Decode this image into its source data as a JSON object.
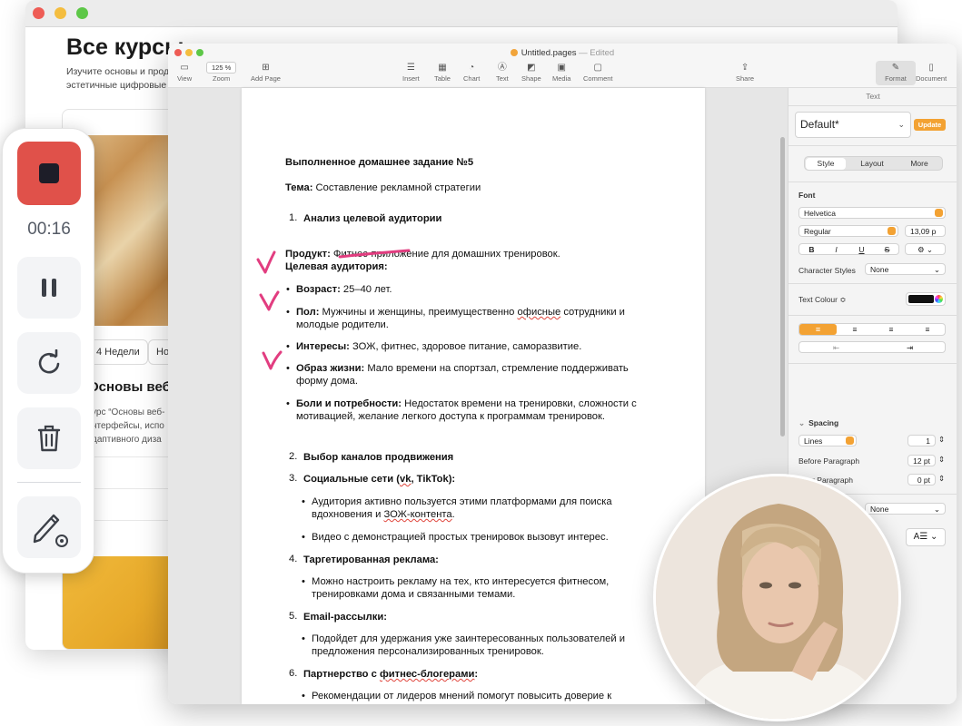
{
  "background_page": {
    "title": "Все курсы",
    "subtitle": "Изучите основы и продв эстетичные цифровые п",
    "chips": [
      "4 Недели",
      "Но"
    ],
    "course_title": "Основы веб",
    "course_desc": "урс “Основы веб- нтерфейсы, испо даптивного диза"
  },
  "recorder": {
    "timer": "00:16"
  },
  "pages": {
    "doc_name": "Untitled.pages",
    "edited": "— Edited",
    "toolbar": {
      "view": "View",
      "zoom_value": "125 %",
      "zoom": "Zoom",
      "add_page": "Add Page",
      "insert": "Insert",
      "table": "Table",
      "chart": "Chart",
      "text": "Text",
      "shape": "Shape",
      "media": "Media",
      "comment": "Comment",
      "share": "Share",
      "format": "Format",
      "document": "Document"
    },
    "doc": {
      "heading": "Выполненное домашнее задание №5",
      "topic_label": "Тема:",
      "topic": " Составление рекламной стратегии",
      "s1": "Анализ целевой аудитории",
      "product_label": "Продукт:",
      "product": " Фитнес-приложение для домашних тренировок.",
      "audience_label": "Целевая аудитория:",
      "age_label": "Возраст:",
      "age": " 25–40 лет.",
      "gender_label": "Пол:",
      "gender_1": " Мужчины и женщины, преимущественно ",
      "gender_office": "офисные",
      "gender_2": " сотрудники и",
      "gender_3": "молодые родители.",
      "interests_label": "Интересы:",
      "interests": " ЗОЖ, фитнес, здоровое питание, саморазвитие.",
      "lifestyle_label": "Образ жизни:",
      "lifestyle_1": " Мало времени на спортзал, стремление поддерживать",
      "lifestyle_2": "форму дома.",
      "pains_label": "Боли и потребности:",
      "pains_1": " Недостаток времени на тренировки, сложности с",
      "pains_2": "мотивацией, желание легкого доступа к программам тренировок.",
      "s2": "Выбор каналов продвижения",
      "s3a": "Социальные сети (",
      "s3vk": "vk",
      "s3b": ", TikTok):",
      "s3_b1_1": "Аудитория активно пользуется этими платформами для поиска",
      "s3_b1_2a": "вдохновения и ",
      "s3_b1_2b": "ЗОЖ-контента",
      "s3_b1_2c": ".",
      "s3_b2": "Видео с демонстрацией простых тренировок вызовут интерес.",
      "s4": "Таргетированная реклама:",
      "s4_b1_1": "Можно настроить рекламу на тех, кто интересуется фитнесом,",
      "s4_b1_2": "тренировками дома и связанными темами.",
      "s5": "Email-рассылки:",
      "s5_b1_1": "Подойдет для удержания уже заинтересованных пользователей и",
      "s5_b1_2": "предложения персонализированных тренировок.",
      "s6a": "Партнерство с ",
      "s6b": "фитнес-блогерами",
      "s6c": ":",
      "s6_b1_1": "Рекомендации от лидеров мнений помогут повысить доверие к",
      "s6_b1_2": "приложению.",
      "nums": [
        "1.",
        "2.",
        "3.",
        "4.",
        "5.",
        "6."
      ]
    },
    "sidebar": {
      "header": "Text",
      "style_name": "Default*",
      "update": "Update",
      "tabs": [
        "Style",
        "Layout",
        "More"
      ],
      "font_label": "Font",
      "font_family": "Helvetica",
      "font_weight": "Regular",
      "font_size": "13,09 p",
      "bold": "B",
      "italic": "I",
      "underline": "U",
      "strike": "S",
      "character_styles": "Character Styles",
      "character_styles_value": "None",
      "text_colour": "Text Colour ≎",
      "spacing": "Spacing",
      "lines": "Lines",
      "lines_value": "1",
      "before_paragraph": "Before Paragraph",
      "before_value": "12 pt",
      "after_paragraph": "After Paragraph",
      "after_value": "0 pt",
      "lists_partial": "sts",
      "lists_value": "None"
    }
  },
  "colors": {
    "accent_orange": "#f3a233",
    "record_red": "#e0514a",
    "annotation_pink": "#e23d80"
  }
}
